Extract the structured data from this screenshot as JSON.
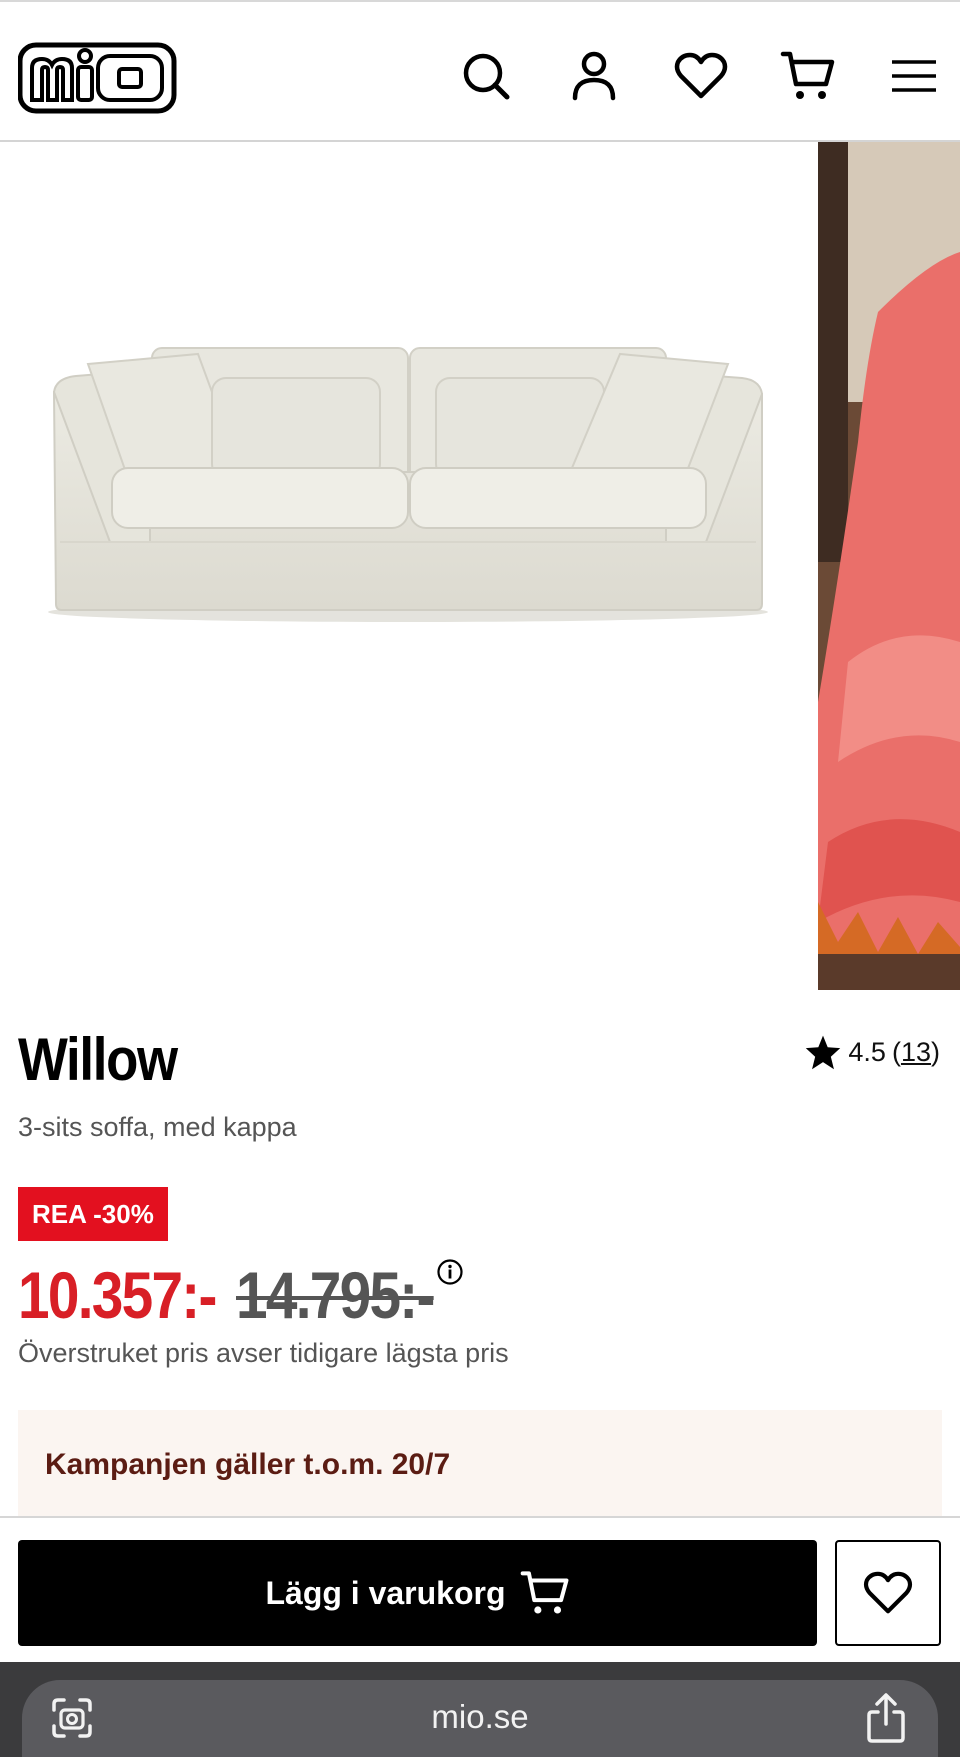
{
  "header": {
    "logo_text": "mio",
    "icons": [
      "search-icon",
      "account-icon",
      "heart-icon",
      "cart-icon",
      "menu-icon"
    ]
  },
  "gallery": {
    "slides": [
      "sofa-photo",
      "pink-throw-photo"
    ]
  },
  "product": {
    "name": "Willow",
    "subtitle": "3-sits soffa, med kappa",
    "rating": "4.5",
    "review_count": "13",
    "badge": "REA -30%",
    "price_current": "10.357:-",
    "price_previous": "14.795:-",
    "price_note": "Överstruket pris avser tidigare lägsta pris",
    "campaign": "Kampanjen gäller t.o.m. 20/7"
  },
  "actions": {
    "add_to_cart": "Lägg i varukorg"
  },
  "browser": {
    "url": "mio.se"
  },
  "colors": {
    "sale_red": "#e3101f",
    "price_red": "#d81f26",
    "campaign_bg": "#fbf5f1",
    "campaign_text": "#5b1c13"
  }
}
